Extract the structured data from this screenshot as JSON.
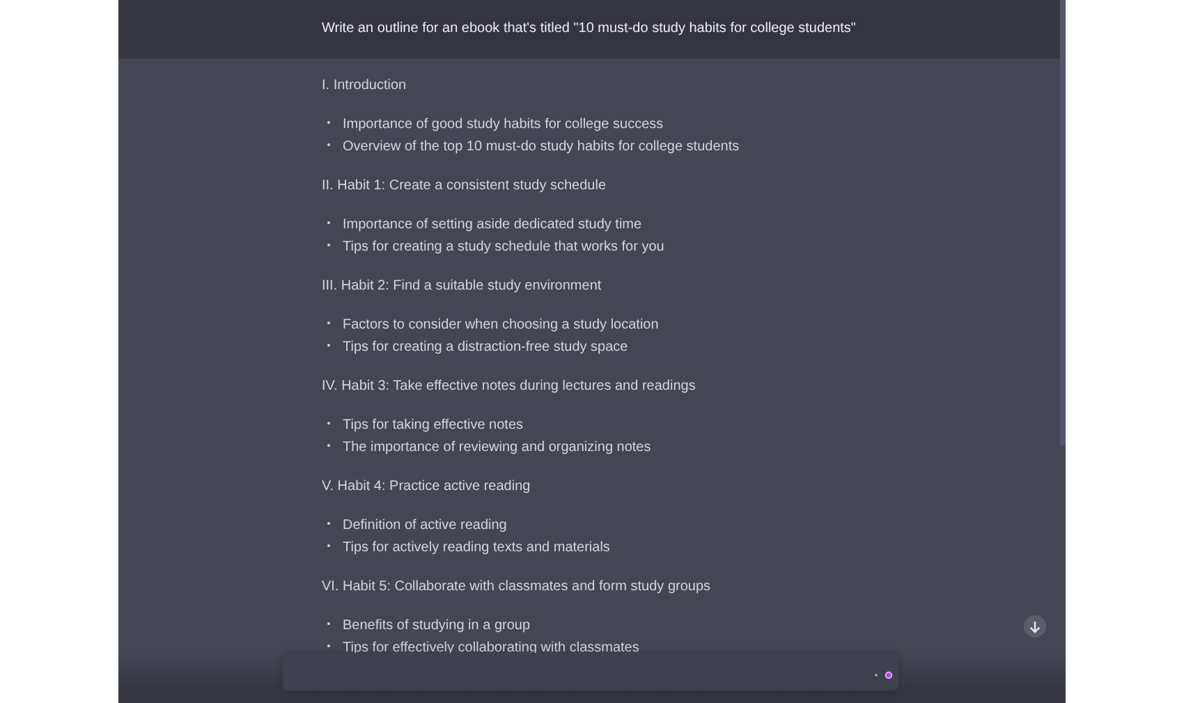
{
  "prompt": "Write an outline for an ebook that's titled \"10 must-do study habits for college students\"",
  "sections": [
    {
      "heading": "I. Introduction",
      "bullets": [
        "Importance of good study habits for college success",
        "Overview of the top 10 must-do study habits for college students"
      ]
    },
    {
      "heading": "II. Habit 1: Create a consistent study schedule",
      "bullets": [
        "Importance of setting aside dedicated study time",
        "Tips for creating a study schedule that works for you"
      ]
    },
    {
      "heading": "III. Habit 2: Find a suitable study environment",
      "bullets": [
        "Factors to consider when choosing a study location",
        "Tips for creating a distraction-free study space"
      ]
    },
    {
      "heading": "IV. Habit 3: Take effective notes during lectures and readings",
      "bullets": [
        "Tips for taking effective notes",
        "The importance of reviewing and organizing notes"
      ]
    },
    {
      "heading": "V. Habit 4: Practice active reading",
      "bullets": [
        "Definition of active reading",
        "Tips for actively reading texts and materials"
      ]
    },
    {
      "heading": "VI. Habit 5: Collaborate with classmates and form study groups",
      "bullets": [
        "Benefits of studying in a group",
        "Tips for effectively collaborating with classmates"
      ]
    }
  ]
}
